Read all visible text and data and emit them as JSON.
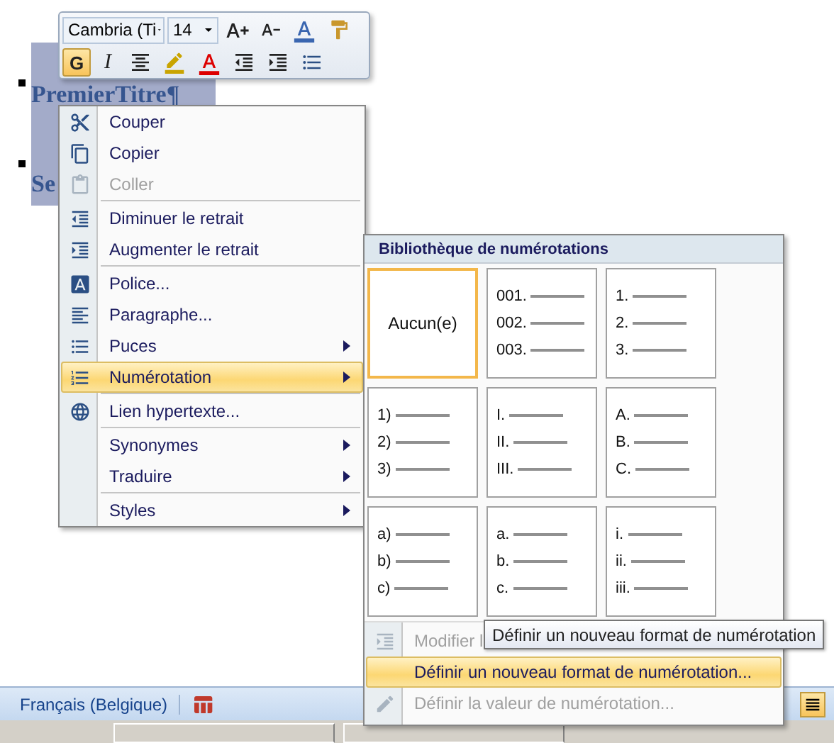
{
  "mini_toolbar": {
    "font": {
      "value": "Cambria (Ti"
    },
    "size": {
      "value": "14"
    },
    "bold": {
      "label": "G",
      "on": true
    },
    "italic": {
      "label": "I",
      "on": false
    }
  },
  "document": {
    "paragraphs": [
      {
        "text": "PremierTitre¶"
      },
      {
        "text": "Se"
      }
    ]
  },
  "context_menu": {
    "items": [
      {
        "kind": "item",
        "label": "Couper",
        "disabled": false,
        "selected": false,
        "submenu": false
      },
      {
        "kind": "item",
        "label": "Copier",
        "disabled": false,
        "selected": false,
        "submenu": false
      },
      {
        "kind": "item",
        "label": "Coller",
        "disabled": true,
        "selected": false,
        "submenu": false
      },
      {
        "kind": "separator"
      },
      {
        "kind": "item",
        "label": "Diminuer le retrait",
        "disabled": false,
        "selected": false,
        "submenu": false
      },
      {
        "kind": "item",
        "label": "Augmenter le retrait",
        "disabled": false,
        "selected": false,
        "submenu": false
      },
      {
        "kind": "separator"
      },
      {
        "kind": "item",
        "label": "Police...",
        "disabled": false,
        "selected": false,
        "submenu": false
      },
      {
        "kind": "item",
        "label": "Paragraphe...",
        "disabled": false,
        "selected": false,
        "submenu": false
      },
      {
        "kind": "item",
        "label": "Puces",
        "disabled": false,
        "selected": false,
        "submenu": true
      },
      {
        "kind": "item",
        "label": "Numérotation",
        "disabled": false,
        "selected": true,
        "submenu": true
      },
      {
        "kind": "separator"
      },
      {
        "kind": "item",
        "label": "Lien hypertexte...",
        "disabled": false,
        "selected": false,
        "submenu": false
      },
      {
        "kind": "separator"
      },
      {
        "kind": "item",
        "label": "Synonymes",
        "disabled": false,
        "selected": false,
        "submenu": true
      },
      {
        "kind": "item",
        "label": "Traduire",
        "disabled": false,
        "selected": false,
        "submenu": true
      },
      {
        "kind": "separator"
      },
      {
        "kind": "item",
        "label": "Styles",
        "disabled": false,
        "selected": false,
        "submenu": true
      }
    ]
  },
  "numbering_menu": {
    "title": "Bibliothèque de numérotations",
    "tiles": [
      {
        "kind": "none",
        "label": "Aucun(e)",
        "selected": true
      },
      {
        "kind": "list",
        "markers": [
          "001.",
          "002.",
          "003."
        ],
        "selected": false
      },
      {
        "kind": "list",
        "markers": [
          "1.",
          "2.",
          "3."
        ],
        "selected": false
      },
      {
        "kind": "list",
        "markers": [
          "1)",
          "2)",
          "3)"
        ],
        "selected": false
      },
      {
        "kind": "list",
        "markers": [
          "I.",
          "II.",
          "III."
        ],
        "selected": false
      },
      {
        "kind": "list",
        "markers": [
          "A.",
          "B.",
          "C."
        ],
        "selected": false
      },
      {
        "kind": "list",
        "markers": [
          "a)",
          "b)",
          "c)"
        ],
        "selected": false
      },
      {
        "kind": "list",
        "markers": [
          "a.",
          "b.",
          "c."
        ],
        "selected": false
      },
      {
        "kind": "list",
        "markers": [
          "i.",
          "ii.",
          "iii."
        ],
        "selected": false
      }
    ],
    "items": [
      {
        "label": "Modifier l",
        "disabled": true,
        "selected": false
      },
      {
        "label": "Définir un nouveau format de numérotation...",
        "disabled": false,
        "selected": true
      },
      {
        "label": "Définir la valeur de numérotation...",
        "disabled": true,
        "selected": false
      }
    ]
  },
  "tooltip": {
    "text": "Définir un nouveau format de numérotation"
  },
  "status_bar": {
    "language": "Français (Belgique)"
  }
}
